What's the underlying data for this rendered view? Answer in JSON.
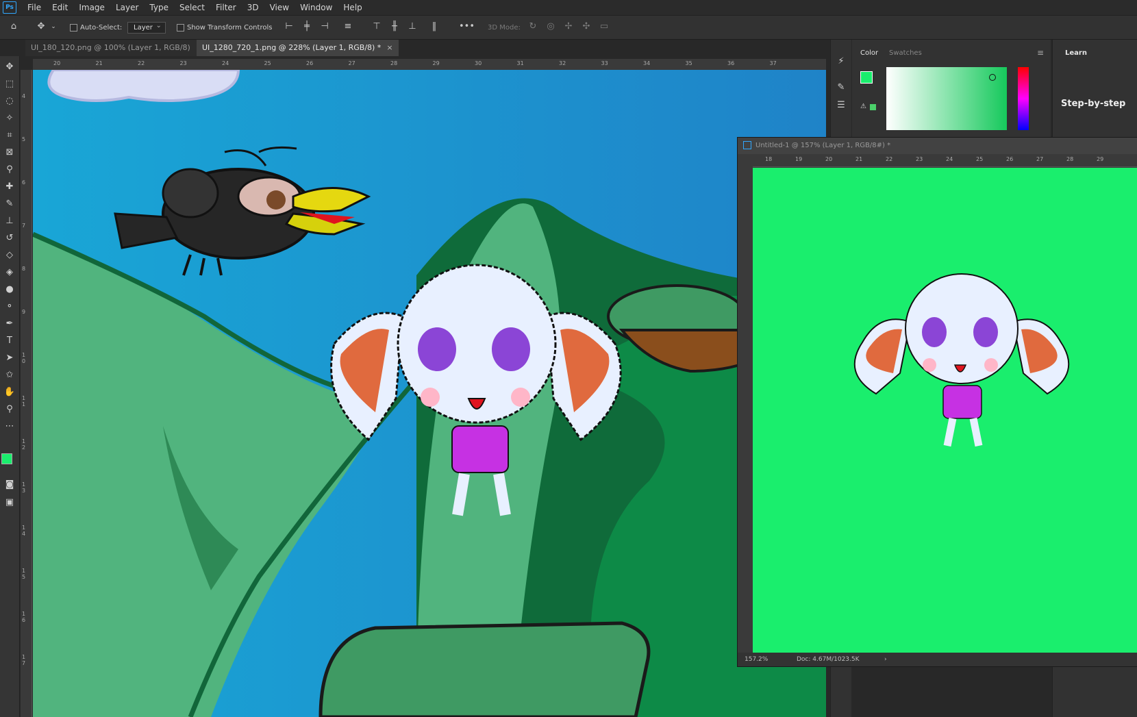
{
  "app": {
    "logo": "Ps"
  },
  "menu": [
    "File",
    "Edit",
    "Image",
    "Layer",
    "Type",
    "Select",
    "Filter",
    "3D",
    "View",
    "Window",
    "Help"
  ],
  "options": {
    "auto_select_label": "Auto-Select:",
    "auto_select_value": "Layer",
    "transform_label": "Show Transform Controls",
    "mode_label": "3D Mode:",
    "more": "•••"
  },
  "tabs": [
    {
      "label": "UI_180_120.png @ 100% (Layer 1, RGB/8)",
      "close": "×"
    },
    {
      "label": "UI_1280_720_1.png @ 228% (Layer 1, RGB/8) *",
      "close": "×"
    }
  ],
  "ruler_h": [
    "20",
    "21",
    "22",
    "23",
    "24",
    "25",
    "26",
    "27",
    "28",
    "29",
    "30",
    "31",
    "32",
    "33",
    "34",
    "35",
    "36",
    "37"
  ],
  "ruler_v": [
    "4",
    "5",
    "6",
    "7",
    "8",
    "9",
    "1 0",
    "1 1",
    "1 2",
    "1 3",
    "1 4",
    "1 5",
    "1 6",
    "1 7"
  ],
  "panel": {
    "tabs": [
      "Color",
      "Swatches"
    ],
    "learn_tab": "Learn",
    "learn_heading": "Step-by-step",
    "foreground_color": "#1aee6d",
    "background_color": "#ffffff"
  },
  "doc_window": {
    "title": "Untitled-1 @ 157% (Layer 1, RGB/8#) *",
    "ruler_h": [
      "18",
      "19",
      "20",
      "21",
      "22",
      "23",
      "24",
      "25",
      "26",
      "27",
      "28",
      "29"
    ],
    "zoom": "157.2%",
    "doc_info": "Doc: 4.67M/1023.5K",
    "canvas_color": "#1aee6d"
  }
}
